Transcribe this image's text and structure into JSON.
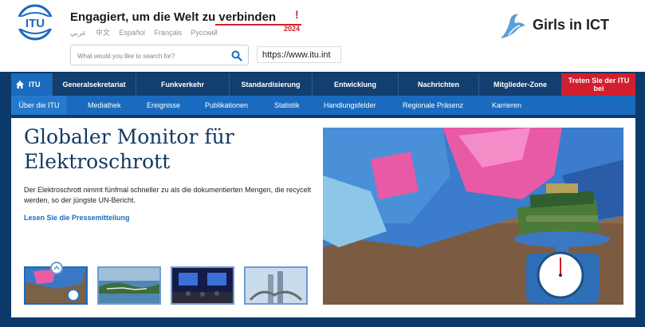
{
  "header": {
    "tagline": "Engagiert, um die Welt zu verbinden",
    "tagline_mark": "!",
    "tagline_year": "2024",
    "languages": [
      "عربي",
      "中文",
      "Español",
      "Français",
      "Русский"
    ],
    "search_placeholder": "What would you like to search for?",
    "url": "https://www.itu.int",
    "partner_label": "Girls in ICT"
  },
  "main_nav": [
    {
      "label": "ITU",
      "icon": "home-icon"
    },
    {
      "label": "Generalsekretariat"
    },
    {
      "label": "Funkverkehr"
    },
    {
      "label": "Standardisierung"
    },
    {
      "label": "Entwicklung"
    },
    {
      "label": "Nachrichten"
    },
    {
      "label": "Mitglieder-Zone"
    },
    {
      "label": "Treten Sie der ITU bei"
    }
  ],
  "sub_nav": [
    "Über die ITU",
    "Mediathek",
    "Ereignisse",
    "Publikationen",
    "Statistik",
    "Handlungsfelder",
    "Regionale Präsenz",
    "Karrieren"
  ],
  "feature": {
    "headline": "Globaler Monitor für Elektroschrott",
    "summary": "Der Elektroschrott nimmt fünfmal schneller zu als die dokumentierten Mengen, die recycelt werden, so der jüngste UN-Bericht.",
    "link_label": "Lesen Sie die Pressemitteilung"
  },
  "colors": {
    "brand_blue": "#1a6bbf",
    "nav_dark": "#123f6f",
    "accent_red": "#d21f2f",
    "headline_blue": "#123a63"
  }
}
